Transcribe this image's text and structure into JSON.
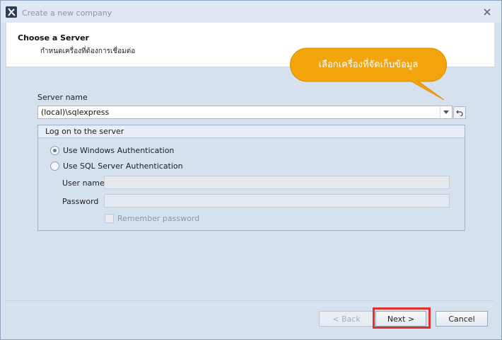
{
  "window": {
    "title": "Create a new company"
  },
  "header": {
    "title": "Choose a Server",
    "subtitle": "กำหนดเครื่องที่ต้องการเชื่อมต่อ"
  },
  "callout": {
    "text": "เลือกเครื่องที่จัดเก็บข้อมูล",
    "color": "#f2a40c"
  },
  "server": {
    "label": "Server name",
    "value": "(local)\\sqlexpress"
  },
  "logon": {
    "title": "Log on to the server",
    "windows_auth": "Use Windows Authentication",
    "sql_auth": "Use SQL Server Authentication",
    "selected": "windows",
    "username_label": "User name",
    "username_value": "",
    "password_label": "Password",
    "password_value": "",
    "remember_label": "Remember password"
  },
  "buttons": {
    "back": "< Back",
    "next": "Next >",
    "cancel": "Cancel"
  },
  "colors": {
    "highlight": "#e03030",
    "window_bg": "#d6e1ee",
    "header_bg": "#ffffff"
  }
}
